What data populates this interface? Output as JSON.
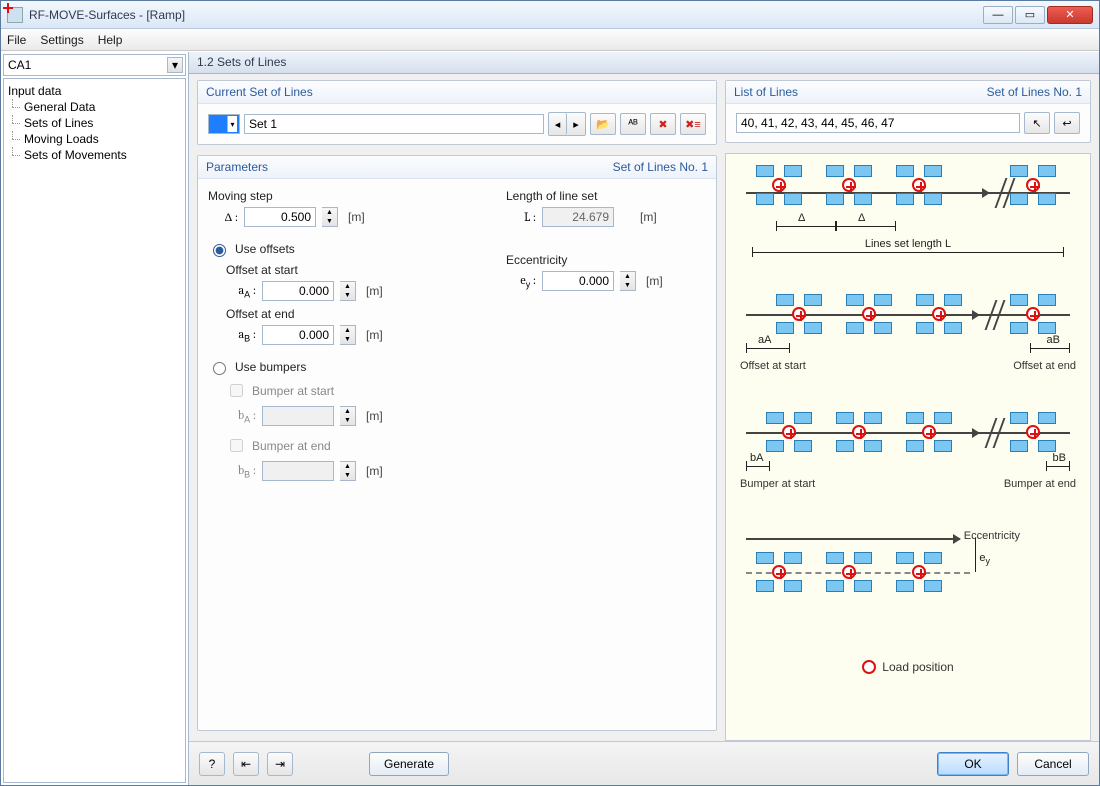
{
  "window": {
    "title": "RF-MOVE-Surfaces - [Ramp]"
  },
  "menu": {
    "file": "File",
    "settings": "Settings",
    "help": "Help"
  },
  "sidebar": {
    "combo": "CA1",
    "root": "Input data",
    "items": [
      "General Data",
      "Sets of Lines",
      "Moving Loads",
      "Sets of Movements"
    ]
  },
  "header": "1.2 Sets of Lines",
  "currentSet": {
    "title": "Current Set of Lines",
    "name": "Set 1"
  },
  "listOfLines": {
    "title": "List of Lines",
    "badge": "Set of Lines No. 1",
    "value": "40, 41, 42, 43, 44, 45, 46, 47"
  },
  "params": {
    "title": "Parameters",
    "badge": "Set of Lines No. 1",
    "movingStep": {
      "label": "Moving step",
      "sym": "Δ :",
      "value": "0.500",
      "unit": "[m]"
    },
    "length": {
      "label": "Length of line set",
      "sym": "L :",
      "value": "24.679",
      "unit": "[m]"
    },
    "useOffsets": {
      "label": "Use offsets",
      "offsetStart": {
        "label": "Offset at start",
        "sym": "aA :",
        "value": "0.000",
        "unit": "[m]"
      },
      "offsetEnd": {
        "label": "Offset at end",
        "sym": "aB :",
        "value": "0.000",
        "unit": "[m]"
      }
    },
    "ecc": {
      "label": "Eccentricity",
      "sym": "ey :",
      "value": "0.000",
      "unit": "[m]"
    },
    "useBumpers": {
      "label": "Use bumpers",
      "bStart": {
        "label": "Bumper at start",
        "sym": "bA :",
        "unit": "[m]"
      },
      "bEnd": {
        "label": "Bumper at end",
        "sym": "bB :",
        "unit": "[m]"
      }
    }
  },
  "diagram": {
    "delta": "Δ",
    "lenLabel": "Lines set length L",
    "offStart": "Offset at start",
    "offEnd": "Offset at end",
    "aA": "aA",
    "aB": "aB",
    "bumpStart": "Bumper at start",
    "bumpEnd": "Bumper at end",
    "bA": "bA",
    "bB": "bB",
    "ecc": "Eccentricity",
    "ey": "ey",
    "legend": "Load position"
  },
  "footer": {
    "generate": "Generate",
    "ok": "OK",
    "cancel": "Cancel"
  }
}
